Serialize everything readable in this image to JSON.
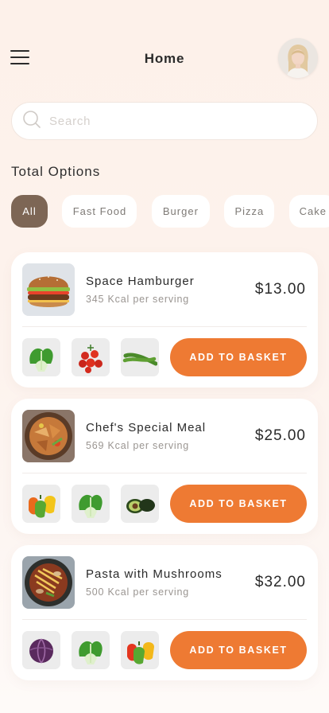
{
  "header": {
    "title": "Home",
    "menu_icon": "hamburger-menu-icon",
    "avatar_icon": "user-avatar"
  },
  "search": {
    "placeholder": "Search",
    "value": "",
    "icon": "search-icon"
  },
  "categories": {
    "title": "Total Options",
    "items": [
      {
        "label": "All",
        "active": true
      },
      {
        "label": "Fast Food",
        "active": false
      },
      {
        "label": "Burger",
        "active": false
      },
      {
        "label": "Pizza",
        "active": false
      },
      {
        "label": "Cake",
        "active": false
      }
    ]
  },
  "meals": [
    {
      "name": "Space Hamburger",
      "kcal": "345 Kcal per serving",
      "price": "$13.00",
      "button_label": "ADD TO BASKET",
      "image": "hamburger-image",
      "ingredients": [
        "bok-choy-icon",
        "cherry-tomatoes-icon",
        "green-beans-icon"
      ]
    },
    {
      "name": "Chef's Special Meal",
      "kcal": "569 Kcal per serving",
      "price": "$25.00",
      "button_label": "ADD TO BASKET",
      "image": "chicken-bowl-image",
      "ingredients": [
        "bell-peppers-icon",
        "bok-choy-icon",
        "avocado-icon"
      ]
    },
    {
      "name": "Pasta with Mushrooms",
      "kcal": "500 Kcal per serving",
      "price": "$32.00",
      "button_label": "ADD TO BASKET",
      "image": "pasta-bowl-image",
      "ingredients": [
        "red-cabbage-icon",
        "bok-choy-icon",
        "bell-peppers-icon"
      ]
    }
  ],
  "colors": {
    "accent": "#ee7a33",
    "chip_active": "#7d6655",
    "background": "#fdf2ec"
  }
}
